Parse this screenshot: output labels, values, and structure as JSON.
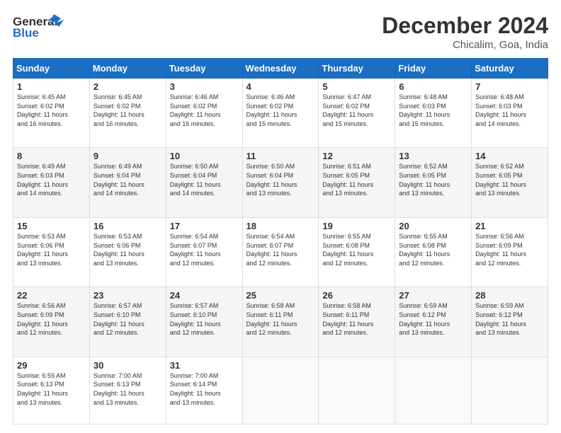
{
  "header": {
    "logo_line1": "General",
    "logo_line2": "Blue",
    "month": "December 2024",
    "location": "Chicalim, Goa, India"
  },
  "days_of_week": [
    "Sunday",
    "Monday",
    "Tuesday",
    "Wednesday",
    "Thursday",
    "Friday",
    "Saturday"
  ],
  "weeks": [
    [
      {
        "day": "1",
        "info": "Sunrise: 6:45 AM\nSunset: 6:02 PM\nDaylight: 11 hours\nand 16 minutes."
      },
      {
        "day": "2",
        "info": "Sunrise: 6:45 AM\nSunset: 6:02 PM\nDaylight: 11 hours\nand 16 minutes."
      },
      {
        "day": "3",
        "info": "Sunrise: 6:46 AM\nSunset: 6:02 PM\nDaylight: 11 hours\nand 16 minutes."
      },
      {
        "day": "4",
        "info": "Sunrise: 6:46 AM\nSunset: 6:02 PM\nDaylight: 11 hours\nand 15 minutes."
      },
      {
        "day": "5",
        "info": "Sunrise: 6:47 AM\nSunset: 6:02 PM\nDaylight: 11 hours\nand 15 minutes."
      },
      {
        "day": "6",
        "info": "Sunrise: 6:48 AM\nSunset: 6:03 PM\nDaylight: 11 hours\nand 15 minutes."
      },
      {
        "day": "7",
        "info": "Sunrise: 6:48 AM\nSunset: 6:03 PM\nDaylight: 11 hours\nand 14 minutes."
      }
    ],
    [
      {
        "day": "8",
        "info": "Sunrise: 6:49 AM\nSunset: 6:03 PM\nDaylight: 11 hours\nand 14 minutes."
      },
      {
        "day": "9",
        "info": "Sunrise: 6:49 AM\nSunset: 6:04 PM\nDaylight: 11 hours\nand 14 minutes."
      },
      {
        "day": "10",
        "info": "Sunrise: 6:50 AM\nSunset: 6:04 PM\nDaylight: 11 hours\nand 14 minutes."
      },
      {
        "day": "11",
        "info": "Sunrise: 6:50 AM\nSunset: 6:04 PM\nDaylight: 11 hours\nand 13 minutes."
      },
      {
        "day": "12",
        "info": "Sunrise: 6:51 AM\nSunset: 6:05 PM\nDaylight: 11 hours\nand 13 minutes."
      },
      {
        "day": "13",
        "info": "Sunrise: 6:52 AM\nSunset: 6:05 PM\nDaylight: 11 hours\nand 13 minutes."
      },
      {
        "day": "14",
        "info": "Sunrise: 6:52 AM\nSunset: 6:05 PM\nDaylight: 11 hours\nand 13 minutes."
      }
    ],
    [
      {
        "day": "15",
        "info": "Sunrise: 6:53 AM\nSunset: 6:06 PM\nDaylight: 11 hours\nand 13 minutes."
      },
      {
        "day": "16",
        "info": "Sunrise: 6:53 AM\nSunset: 6:06 PM\nDaylight: 11 hours\nand 13 minutes."
      },
      {
        "day": "17",
        "info": "Sunrise: 6:54 AM\nSunset: 6:07 PM\nDaylight: 11 hours\nand 12 minutes."
      },
      {
        "day": "18",
        "info": "Sunrise: 6:54 AM\nSunset: 6:07 PM\nDaylight: 11 hours\nand 12 minutes."
      },
      {
        "day": "19",
        "info": "Sunrise: 6:55 AM\nSunset: 6:08 PM\nDaylight: 11 hours\nand 12 minutes."
      },
      {
        "day": "20",
        "info": "Sunrise: 6:55 AM\nSunset: 6:08 PM\nDaylight: 11 hours\nand 12 minutes."
      },
      {
        "day": "21",
        "info": "Sunrise: 6:56 AM\nSunset: 6:09 PM\nDaylight: 11 hours\nand 12 minutes."
      }
    ],
    [
      {
        "day": "22",
        "info": "Sunrise: 6:56 AM\nSunset: 6:09 PM\nDaylight: 11 hours\nand 12 minutes."
      },
      {
        "day": "23",
        "info": "Sunrise: 6:57 AM\nSunset: 6:10 PM\nDaylight: 11 hours\nand 12 minutes."
      },
      {
        "day": "24",
        "info": "Sunrise: 6:57 AM\nSunset: 6:10 PM\nDaylight: 11 hours\nand 12 minutes."
      },
      {
        "day": "25",
        "info": "Sunrise: 6:58 AM\nSunset: 6:11 PM\nDaylight: 11 hours\nand 12 minutes."
      },
      {
        "day": "26",
        "info": "Sunrise: 6:58 AM\nSunset: 6:11 PM\nDaylight: 11 hours\nand 12 minutes."
      },
      {
        "day": "27",
        "info": "Sunrise: 6:59 AM\nSunset: 6:12 PM\nDaylight: 11 hours\nand 13 minutes."
      },
      {
        "day": "28",
        "info": "Sunrise: 6:59 AM\nSunset: 6:12 PM\nDaylight: 11 hours\nand 13 minutes."
      }
    ],
    [
      {
        "day": "29",
        "info": "Sunrise: 6:59 AM\nSunset: 6:13 PM\nDaylight: 11 hours\nand 13 minutes."
      },
      {
        "day": "30",
        "info": "Sunrise: 7:00 AM\nSunset: 6:13 PM\nDaylight: 11 hours\nand 13 minutes."
      },
      {
        "day": "31",
        "info": "Sunrise: 7:00 AM\nSunset: 6:14 PM\nDaylight: 11 hours\nand 13 minutes."
      },
      null,
      null,
      null,
      null
    ]
  ]
}
